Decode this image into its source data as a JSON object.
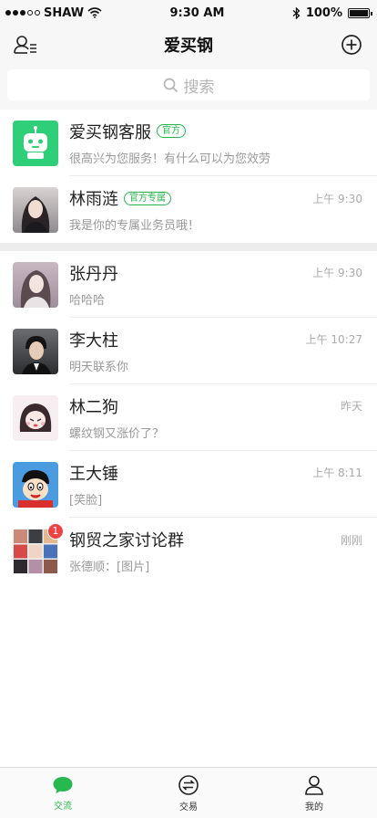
{
  "status": {
    "carrier": "SHAW",
    "time": "9:30 AM",
    "battery": "100%",
    "battery_fraction": 1.0
  },
  "nav": {
    "title": "爱买钢",
    "left_icon": "contacts-icon",
    "right_icon": "add-circle-icon"
  },
  "search": {
    "placeholder": "搜索"
  },
  "pinned": [
    {
      "name": "爱买钢客服",
      "tag": "官方",
      "time": "",
      "message": "很高兴为您服务！有什么可以为您效劳"
    },
    {
      "name": "林雨涟",
      "tag": "官方专属",
      "time": "上午 9:30",
      "message": "我是你的专属业务员哦！"
    }
  ],
  "chats": [
    {
      "name": "张丹丹",
      "time": "上午 9:30",
      "message": "哈哈哈"
    },
    {
      "name": "李大柱",
      "time": "上午 10:27",
      "message": "明天联系你"
    },
    {
      "name": "林二狗",
      "time": "昨天",
      "message": "螺纹钢又涨价了？"
    },
    {
      "name": "王大锤",
      "time": "上午 8:11",
      "message": "[笑脸]"
    },
    {
      "name": "钢贸之家讨论群",
      "time": "刚刚",
      "message": "张德顺：[图片]",
      "badge": "1"
    }
  ],
  "tabs": [
    {
      "label": "交流",
      "icon": "chat-bubble-icon",
      "active": true
    },
    {
      "label": "交易",
      "icon": "exchange-icon",
      "active": false
    },
    {
      "label": "我的",
      "icon": "person-icon",
      "active": false
    }
  ],
  "colors": {
    "accent": "#27b84f",
    "badge": "#f04242",
    "bot_avatar": "#2fcf7a"
  }
}
